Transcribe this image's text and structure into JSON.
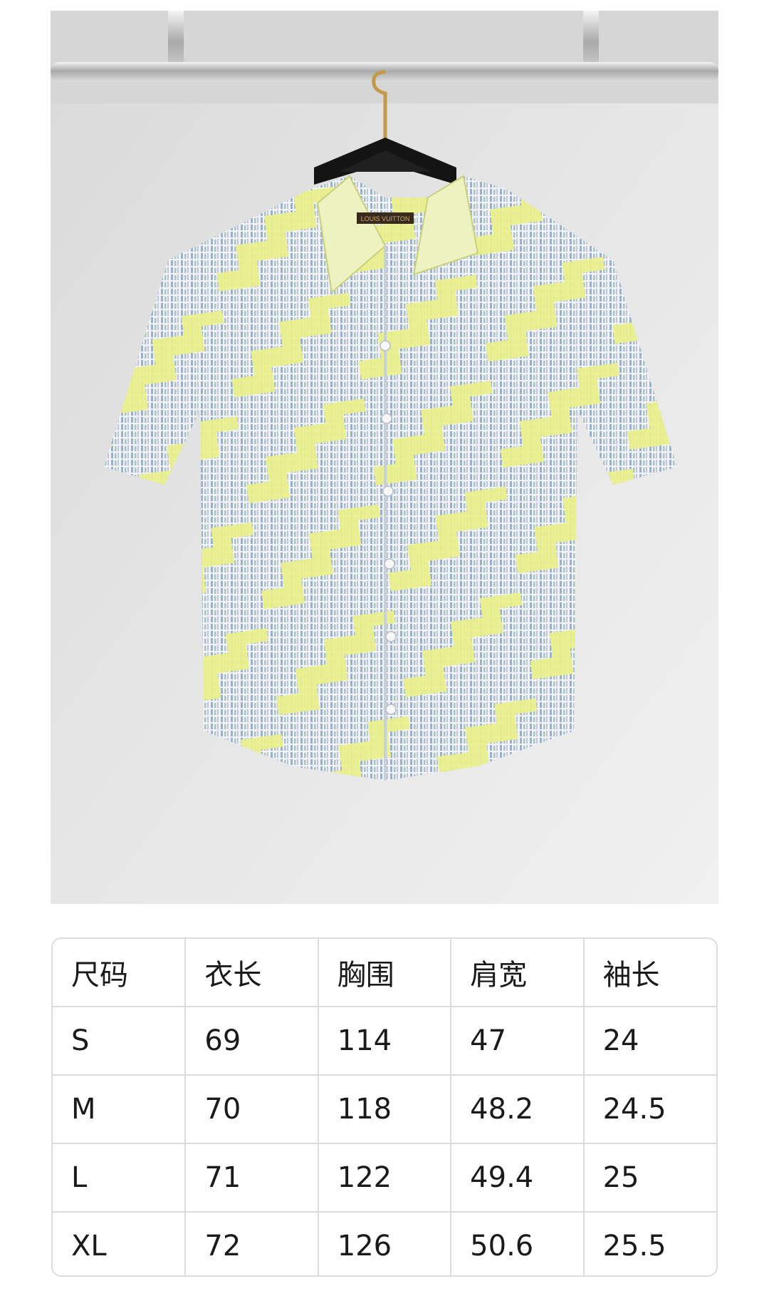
{
  "photo": {
    "label_text": "LOUIS VUITTON",
    "colors": {
      "wall": "#e2e2e2",
      "shirt_base": "#eef1f4",
      "shirt_zigzag": "#e9ef7c",
      "shirt_stripe_blue": "#6f8fb0",
      "shirt_stripe_green": "#6aa39a",
      "hanger": "#141414",
      "rail": "#b4b4b4"
    }
  },
  "size_table": {
    "headers": [
      "尺码",
      "衣长",
      "胸围",
      "肩宽",
      "袖长"
    ],
    "rows": [
      [
        "S",
        "69",
        "114",
        "47",
        "24"
      ],
      [
        "M",
        "70",
        "118",
        "48.2",
        "24.5"
      ],
      [
        "L",
        "71",
        "122",
        "49.4",
        "25"
      ],
      [
        "XL",
        "72",
        "126",
        "50.6",
        "25.5"
      ]
    ]
  }
}
